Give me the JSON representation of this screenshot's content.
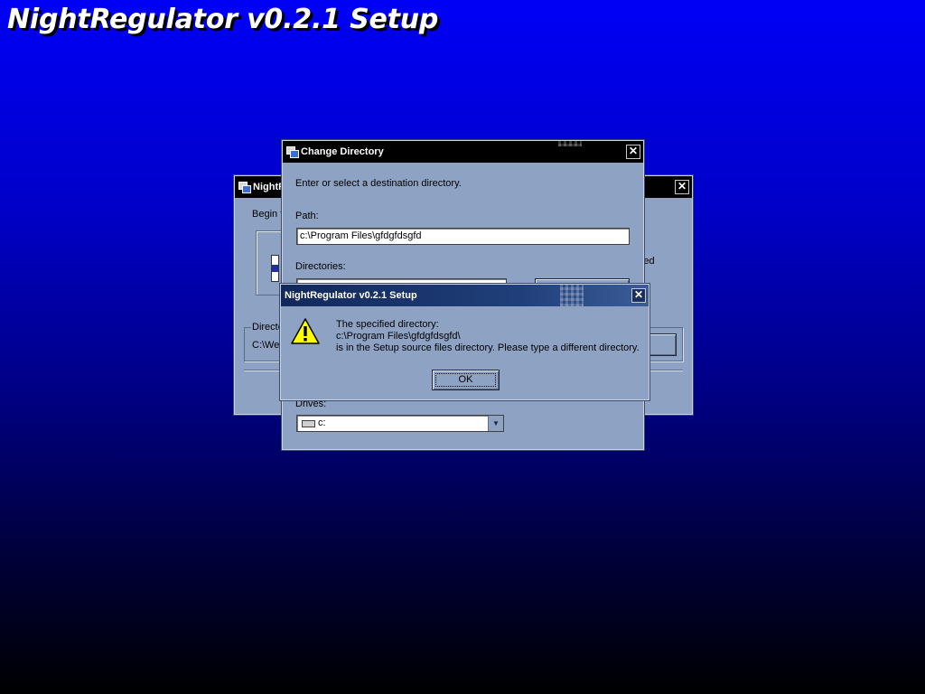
{
  "installer": {
    "title": "NightRegulator v0.2.1 Setup"
  },
  "background_window": {
    "title_partial": "NightR",
    "begin_text_partial": "Begin t",
    "right_text_partial": "ied",
    "directory_group_label_partial": "Directo",
    "directory_path_partial": "C:\\We"
  },
  "change_directory": {
    "title": "Change Directory",
    "instruction": "Enter or select a destination directory.",
    "path_label": "Path:",
    "path_value": "c:\\Program Files\\gfdgfdsgfd",
    "directories_label": "Directories:",
    "drives_label": "Drives:",
    "drive_value": "c:"
  },
  "alert": {
    "title": "NightRegulator v0.2.1 Setup",
    "line1": "The specified directory:",
    "line2": "c:\\Program Files\\gfdgfdsgfd\\",
    "line3": "is in the Setup source files directory. Please type a different directory.",
    "ok_label": "OK"
  },
  "colors": {
    "dialog_face": "#8ea2c4",
    "titlebar_active": "#000000",
    "background_top": "#0000f6",
    "background_bottom": "#000000"
  }
}
